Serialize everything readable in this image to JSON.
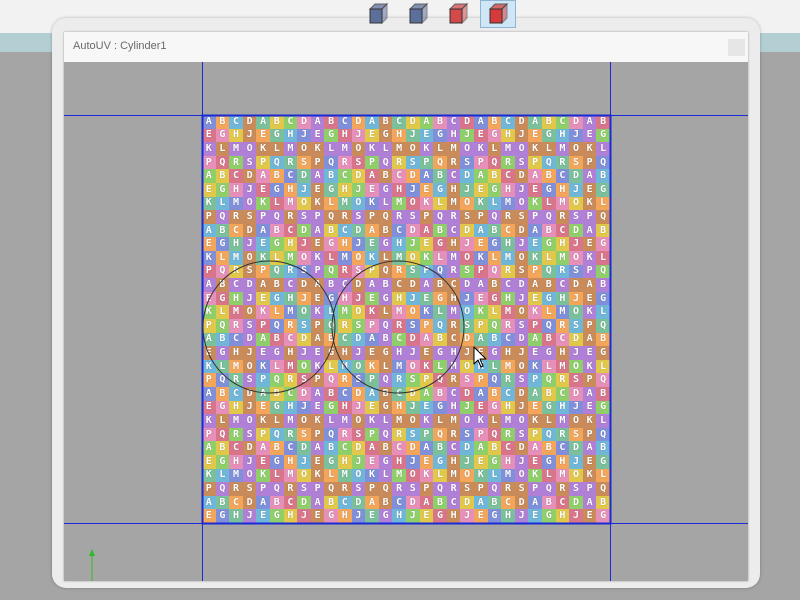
{
  "window": {
    "title": "AutoUV : Cylinder1"
  },
  "toolbar": {
    "buttons": [
      {
        "name": "view-cube-icon",
        "active": false,
        "face": "#5c6f9a"
      },
      {
        "name": "view-cube-icon",
        "active": false,
        "face": "#5c6f9a"
      },
      {
        "name": "view-cube-icon",
        "active": false,
        "face": "#d24a4a"
      },
      {
        "name": "view-cube-icon",
        "active": true,
        "face": "#d63a3a"
      }
    ]
  },
  "texture": {
    "rows": [
      "ABCD",
      "EGHJ",
      "KLMO",
      "PQRS"
    ],
    "palette": [
      "#7f8fd9",
      "#e68fb8",
      "#7ac09a",
      "#f3a65a",
      "#b07fd6",
      "#e2c84a",
      "#6fb6d9",
      "#d9758a",
      "#8fcf6a",
      "#c98b5a"
    ]
  },
  "colors": {
    "background": "#a5a5a5",
    "guide_lines": "#1a2bd6",
    "texture_border": "#1a2bd6",
    "axis_y": "#2dbb2d",
    "axis_x": "#d62020",
    "circles": "#333333"
  }
}
